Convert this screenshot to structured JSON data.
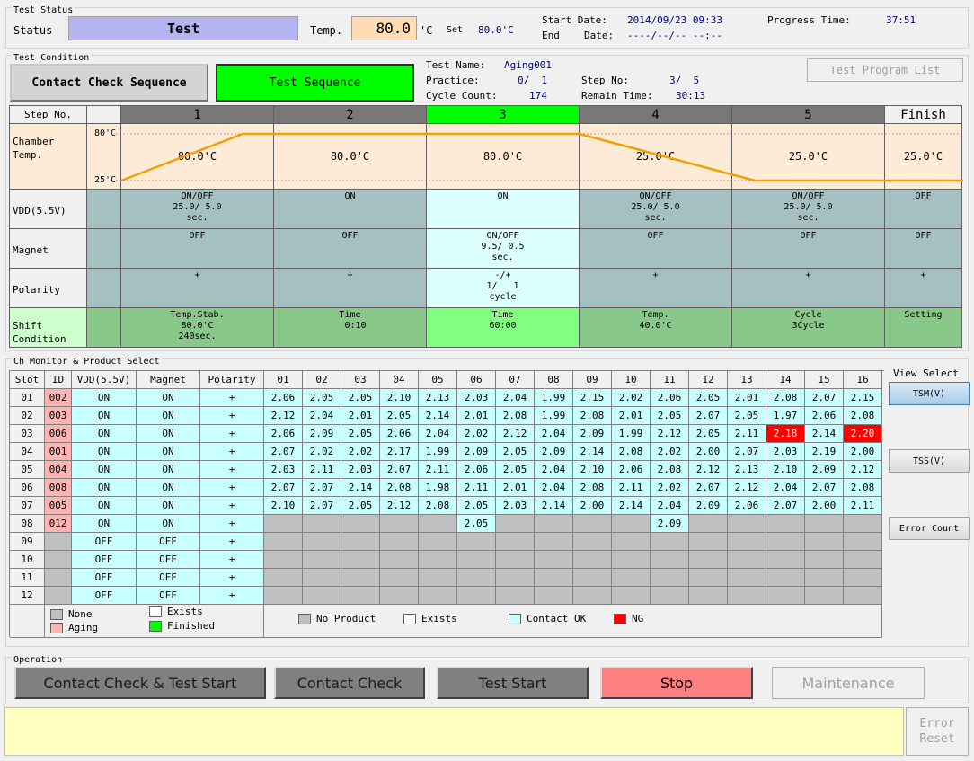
{
  "test_status": {
    "group_title": "Test Status",
    "status_label": "Status",
    "status_value": "Test",
    "temp_label": "Temp.",
    "temp_value": "80.0",
    "temp_unit": "'C",
    "set_label": "Set",
    "set_value": "80.0'C",
    "start_date_label": "Start Date:",
    "start_date_value": "2014/09/23 09:33",
    "end_label": "End",
    "end_date_label": "Date:",
    "end_date_value": "----/--/-- --:--",
    "progress_label": "Progress Time:",
    "progress_value": "37:51"
  },
  "test_condition": {
    "group_title": "Test Condition",
    "contact_check_sequence_label": "Contact Check Sequence",
    "test_sequence_label": "Test Sequence",
    "test_name_label": "Test Name:",
    "test_name_value": "Aging001",
    "practice_label": "Practice:",
    "practice_value": "0/  1",
    "step_no_label": "Step No:",
    "step_no_value": "3/  5",
    "cycle_count_label": "Cycle Count:",
    "cycle_count_value": "174",
    "remain_time_label": "Remain Time:",
    "remain_time_value": "30:13",
    "program_list_label": "Test Program List",
    "header_step_label": "Step No.",
    "steps": [
      "1",
      "2",
      "3",
      "4",
      "5",
      "Finish"
    ],
    "active_step_index": 2,
    "row_labels": {
      "chamber": "Chamber Temp.",
      "vdd": "VDD(5.5V)",
      "magnet": "Magnet",
      "polarity": "Polarity",
      "shift": "Shift Condition"
    },
    "temp_axis": {
      "high": "80'C",
      "low": "25'C"
    },
    "temp_values": [
      "80.0'C",
      "80.0'C",
      "80.0'C",
      "25.0'C",
      "25.0'C",
      "25.0'C"
    ],
    "vdd": [
      [
        "ON/OFF",
        "25.0/ 5.0",
        "sec."
      ],
      [
        "ON"
      ],
      [
        "ON"
      ],
      [
        "ON/OFF",
        "25.0/ 5.0",
        "sec."
      ],
      [
        "ON/OFF",
        "25.0/ 5.0",
        "sec."
      ],
      [
        "OFF"
      ]
    ],
    "magnet": [
      [
        "OFF"
      ],
      [
        "OFF"
      ],
      [
        "ON/OFF",
        "9.5/ 0.5",
        "sec."
      ],
      [
        "OFF"
      ],
      [
        "OFF"
      ],
      [
        "OFF"
      ]
    ],
    "polarity": [
      [
        "+"
      ],
      [
        "+"
      ],
      [
        "-/+",
        "1/   1",
        "cycle"
      ],
      [
        "+"
      ],
      [
        "+"
      ],
      [
        "+"
      ]
    ],
    "shift": [
      [
        "Temp.Stab.",
        "80.0'C",
        "240sec."
      ],
      [
        "Time",
        "  0:10"
      ],
      [
        "Time",
        "60:00"
      ],
      [
        "Temp.",
        "40.0'C"
      ],
      [
        "Cycle",
        "3Cycle"
      ],
      [
        "Setting"
      ]
    ]
  },
  "ch_monitor": {
    "group_title": "Ch Monitor & Product Select",
    "headers": {
      "slot": "Slot",
      "id": "ID",
      "vdd": "VDD(5.5V)",
      "magnet": "Magnet",
      "polarity": "Polarity"
    },
    "channels": [
      "01",
      "02",
      "03",
      "04",
      "05",
      "06",
      "07",
      "08",
      "09",
      "10",
      "11",
      "12",
      "13",
      "14",
      "15",
      "16"
    ],
    "rows": [
      {
        "slot": "01",
        "id": "002",
        "vdd": "ON",
        "magnet": "ON",
        "polarity": "+",
        "values": [
          "2.06",
          "2.05",
          "2.05",
          "2.10",
          "2.13",
          "2.03",
          "2.04",
          "1.99",
          "2.15",
          "2.02",
          "2.06",
          "2.05",
          "2.01",
          "2.08",
          "2.07",
          "2.15"
        ]
      },
      {
        "slot": "02",
        "id": "003",
        "vdd": "ON",
        "magnet": "ON",
        "polarity": "+",
        "values": [
          "2.12",
          "2.04",
          "2.01",
          "2.05",
          "2.14",
          "2.01",
          "2.08",
          "1.99",
          "2.08",
          "2.01",
          "2.05",
          "2.07",
          "2.05",
          "1.97",
          "2.06",
          "2.08"
        ]
      },
      {
        "slot": "03",
        "id": "006",
        "vdd": "ON",
        "magnet": "ON",
        "polarity": "+",
        "values": [
          "2.06",
          "2.09",
          "2.05",
          "2.06",
          "2.04",
          "2.02",
          "2.12",
          "2.04",
          "2.09",
          "1.99",
          "2.12",
          "2.05",
          "2.11",
          "2.18",
          "2.14",
          "2.20"
        ],
        "ng": [
          13,
          15
        ]
      },
      {
        "slot": "04",
        "id": "001",
        "vdd": "ON",
        "magnet": "ON",
        "polarity": "+",
        "values": [
          "2.07",
          "2.02",
          "2.02",
          "2.17",
          "1.99",
          "2.09",
          "2.05",
          "2.09",
          "2.14",
          "2.08",
          "2.02",
          "2.00",
          "2.07",
          "2.03",
          "2.19",
          "2.00"
        ]
      },
      {
        "slot": "05",
        "id": "004",
        "vdd": "ON",
        "magnet": "ON",
        "polarity": "+",
        "values": [
          "2.03",
          "2.11",
          "2.03",
          "2.07",
          "2.11",
          "2.06",
          "2.05",
          "2.04",
          "2.10",
          "2.06",
          "2.08",
          "2.12",
          "2.13",
          "2.10",
          "2.09",
          "2.12"
        ]
      },
      {
        "slot": "06",
        "id": "008",
        "vdd": "ON",
        "magnet": "ON",
        "polarity": "+",
        "values": [
          "2.07",
          "2.07",
          "2.14",
          "2.08",
          "1.98",
          "2.11",
          "2.01",
          "2.04",
          "2.08",
          "2.11",
          "2.02",
          "2.07",
          "2.12",
          "2.04",
          "2.07",
          "2.08"
        ]
      },
      {
        "slot": "07",
        "id": "005",
        "vdd": "ON",
        "magnet": "ON",
        "polarity": "+",
        "values": [
          "2.10",
          "2.07",
          "2.05",
          "2.12",
          "2.08",
          "2.05",
          "2.03",
          "2.14",
          "2.00",
          "2.14",
          "2.04",
          "2.09",
          "2.06",
          "2.07",
          "2.00",
          "2.11"
        ]
      },
      {
        "slot": "08",
        "id": "012",
        "vdd": "ON",
        "magnet": "ON",
        "polarity": "+",
        "values": [
          "",
          "",
          "",
          "",
          "",
          "2.05",
          "",
          "",
          "",
          "",
          "2.09",
          "",
          "",
          "",
          "",
          ""
        ]
      },
      {
        "slot": "09",
        "id": "",
        "vdd": "OFF",
        "magnet": "OFF",
        "polarity": "+",
        "values": [
          "",
          "",
          "",
          "",
          "",
          "",
          "",
          "",
          "",
          "",
          "",
          "",
          "",
          "",
          "",
          ""
        ]
      },
      {
        "slot": "10",
        "id": "",
        "vdd": "OFF",
        "magnet": "OFF",
        "polarity": "+",
        "values": [
          "",
          "",
          "",
          "",
          "",
          "",
          "",
          "",
          "",
          "",
          "",
          "",
          "",
          "",
          "",
          ""
        ]
      },
      {
        "slot": "11",
        "id": "",
        "vdd": "OFF",
        "magnet": "OFF",
        "polarity": "+",
        "values": [
          "",
          "",
          "",
          "",
          "",
          "",
          "",
          "",
          "",
          "",
          "",
          "",
          "",
          "",
          "",
          ""
        ]
      },
      {
        "slot": "12",
        "id": "",
        "vdd": "OFF",
        "magnet": "OFF",
        "polarity": "+",
        "values": [
          "",
          "",
          "",
          "",
          "",
          "",
          "",
          "",
          "",
          "",
          "",
          "",
          "",
          "",
          "",
          ""
        ]
      }
    ],
    "legend_left": {
      "none": "None",
      "exists": "Exists",
      "aging": "Aging",
      "finished": "Finished"
    },
    "legend_right": {
      "no_product": "No Product",
      "exists": "Exists",
      "contact_ok": "Contact OK",
      "ng": "NG"
    },
    "view_select_label": "View Select",
    "tsm_label": "TSM(V)",
    "tss_label": "TSS(V)",
    "error_count_label": "Error Count"
  },
  "operation": {
    "group_title": "Operation",
    "contact_check_test_start": "Contact Check & Test Start",
    "contact_check": "Contact Check",
    "test_start": "Test Start",
    "stop": "Stop",
    "maintenance": "Maintenance"
  },
  "message": {
    "text": ""
  },
  "error_reset": {
    "label_line1": "Error",
    "label_line2": "Reset"
  },
  "colors": {
    "status_bg": "#b4b4f0",
    "temp_bg": "#ffdcb4",
    "active_green": "#00ff00",
    "step_header": "#787878",
    "chamber_bg": "#fdebd8",
    "row_gray": "#a5c0c0",
    "row_active": "#dcffff",
    "shift_bg": "#88c888",
    "shift_active": "#80ff80",
    "contact_ok": "#c8ffff",
    "ng": "#ff0000",
    "aging": "#ffb4b4",
    "no_product": "#c0c0c0",
    "stop_bg": "#ff8080",
    "message_bg": "#ffffc0",
    "temp_line": "#f0a000"
  }
}
